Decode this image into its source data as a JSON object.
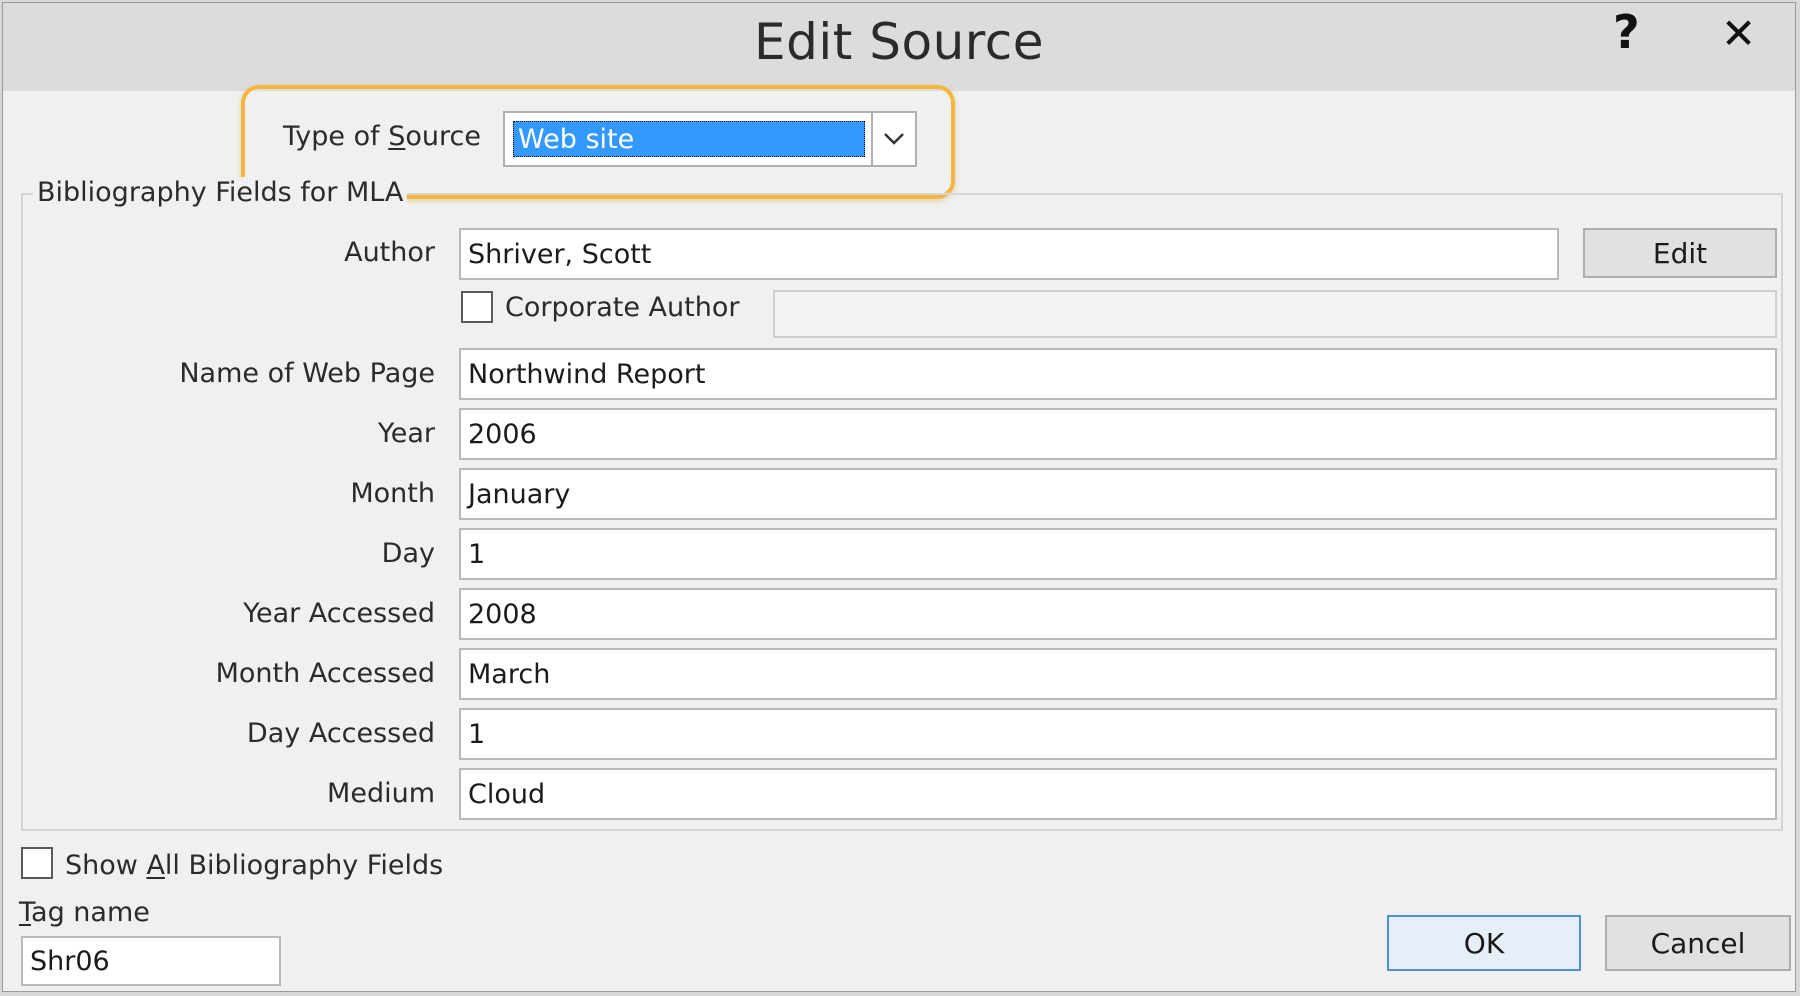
{
  "dialog": {
    "title": "Edit Source",
    "help_glyph": "?",
    "close_glyph": "✕"
  },
  "source_type": {
    "label_prefix": "Type of ",
    "label_mnemonic": "S",
    "label_suffix": "ource",
    "selected": "Web site",
    "highlight_color": "#f4b63e",
    "selection_color": "#3399ff"
  },
  "group": {
    "label": "Bibliography Fields for MLA"
  },
  "fields": {
    "author": {
      "label": "Author",
      "value": "Shriver, Scott"
    },
    "edit_button": "Edit",
    "corporate_author": {
      "label": "Corporate Author",
      "checked": false,
      "value": ""
    },
    "name_of_web_page": {
      "label": "Name of Web Page",
      "value": "Northwind Report"
    },
    "year": {
      "label": "Year",
      "value": "2006"
    },
    "month": {
      "label": "Month",
      "value": "January"
    },
    "day": {
      "label": "Day",
      "value": "1"
    },
    "year_accessed": {
      "label": "Year Accessed",
      "value": "2008"
    },
    "month_accessed": {
      "label": "Month Accessed",
      "value": "March"
    },
    "day_accessed": {
      "label": "Day Accessed",
      "value": "1"
    },
    "medium": {
      "label": "Medium",
      "value": "Cloud"
    }
  },
  "show_all": {
    "label_prefix": "Show ",
    "label_mnemonic": "A",
    "label_suffix": "ll Bibliography Fields",
    "checked": false
  },
  "tag": {
    "label_mnemonic": "T",
    "label_suffix": "ag name",
    "value": "Shr06"
  },
  "buttons": {
    "ok": "OK",
    "cancel": "Cancel"
  }
}
